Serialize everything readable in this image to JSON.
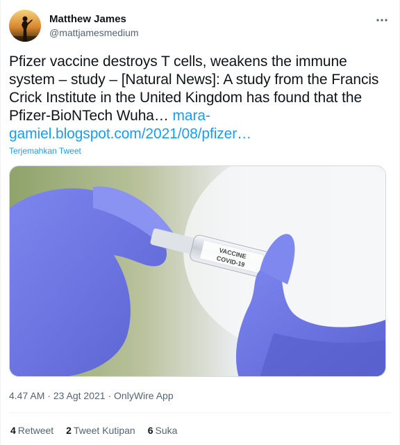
{
  "user": {
    "name": "Matthew James",
    "handle": "@mattjamesmedium"
  },
  "menu": {
    "more_icon": "more-dots-icon"
  },
  "tweet": {
    "text": "Pfizer vaccine destroys T cells, weakens the immune system – study – [Natural News]: A study from the Francis Crick Institute in the United Kingdom has found that the Pfizer-BioNTech Wuha… ",
    "link": "mara-gamiel.blogspot.com/2021/08/pfizer…",
    "translate": "Terjemahkan Tweet"
  },
  "media": {
    "vial_line1": "VACCINE",
    "vial_line2": "COVID-19"
  },
  "meta": {
    "time": "4.47 AM",
    "sep1": " · ",
    "date": "23 Agt 2021",
    "sep2": " · ",
    "source": "OnlyWire App"
  },
  "stats": {
    "retweet_count": "4",
    "retweet_label": "Retweet",
    "quote_count": "2",
    "quote_label": "Tweet Kutipan",
    "like_count": "6",
    "like_label": "Suka"
  },
  "colors": {
    "link": "#1d9bf0",
    "text": "#0f1419",
    "secondary": "#536471",
    "glove": "#6f78e6"
  }
}
